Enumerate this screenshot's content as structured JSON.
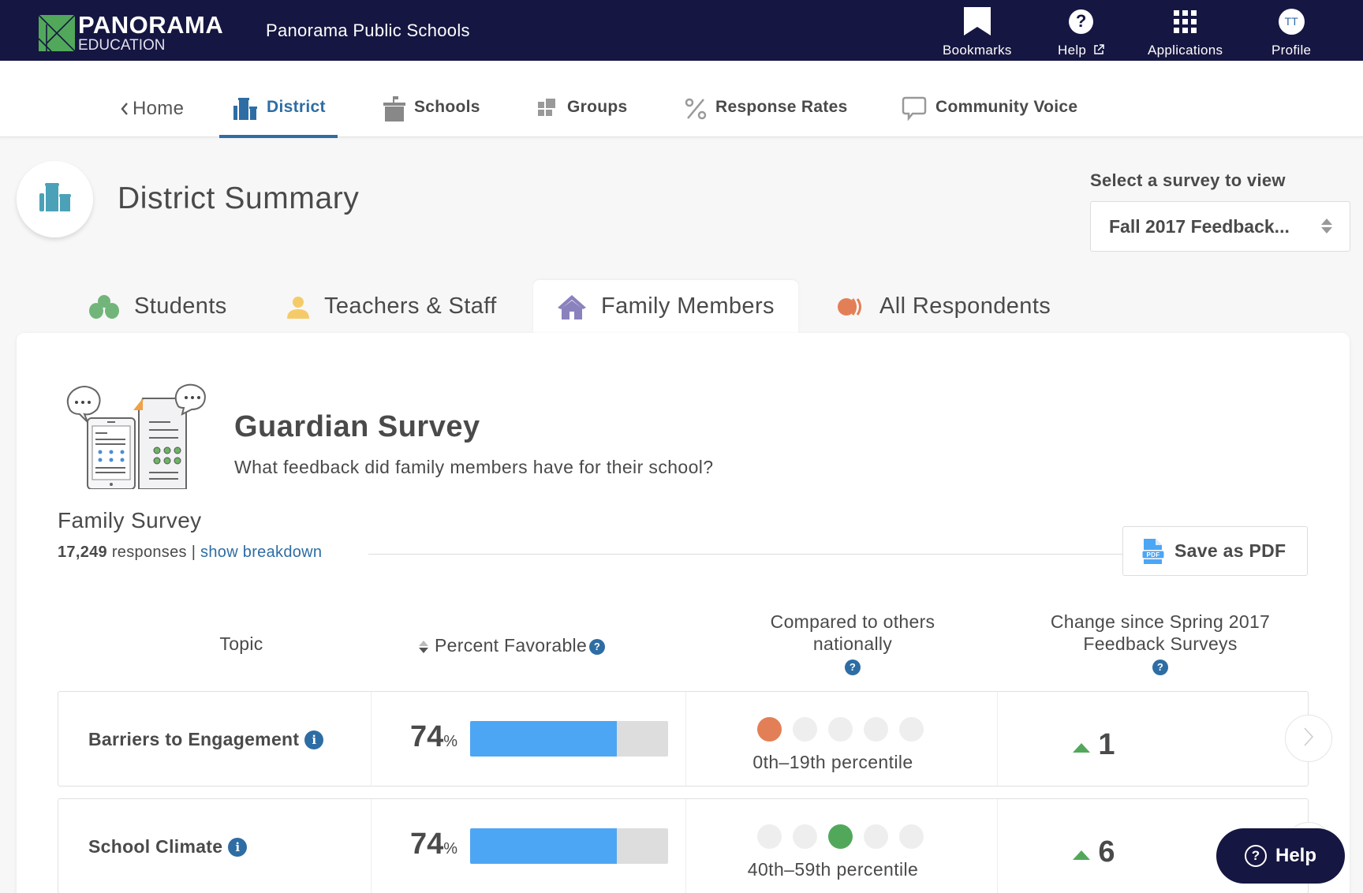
{
  "header": {
    "logo_primary": "PANORAMA",
    "logo_secondary": "EDUCATION",
    "district_name": "Panorama Public Schools",
    "items": [
      {
        "label": "Bookmarks",
        "icon": "bookmark-icon"
      },
      {
        "label": "Help",
        "icon": "help-icon",
        "external": true
      },
      {
        "label": "Applications",
        "icon": "apps-grid-icon"
      },
      {
        "label": "Profile",
        "icon": "avatar",
        "initials": "TT"
      }
    ]
  },
  "nav": {
    "home_label": "Home",
    "items": [
      {
        "label": "District",
        "icon": "district-icon",
        "active": true
      },
      {
        "label": "Schools",
        "icon": "school-podium-icon"
      },
      {
        "label": "Groups",
        "icon": "groups-icon"
      },
      {
        "label": "Response Rates",
        "icon": "percent-icon"
      },
      {
        "label": "Community Voice",
        "icon": "speech-bubble-icon"
      }
    ]
  },
  "page": {
    "title": "District Summary",
    "select_label": "Select a survey to view",
    "selected_survey": "Fall 2017 Feedback..."
  },
  "respondent_tabs": [
    {
      "label": "Students",
      "icon": "students-icon",
      "color": "#72b57a"
    },
    {
      "label": "Teachers & Staff",
      "icon": "teacher-icon",
      "color": "#f5cb6a"
    },
    {
      "label": "Family Members",
      "icon": "house-icon",
      "color": "#8a82bd",
      "active": true
    },
    {
      "label": "All Respondents",
      "icon": "all-respondents-icon",
      "color": "#e37f57"
    }
  ],
  "survey": {
    "title": "Guardian Survey",
    "subtitle": "What feedback did family members have for their school?",
    "name": "Family Survey",
    "response_count": "17,249",
    "responses_word": "responses",
    "separator": "|",
    "breakdown_link": "show breakdown",
    "save_pdf_label": "Save as PDF",
    "pdf_icon_text": "PDF"
  },
  "table": {
    "headers": {
      "topic": "Topic",
      "percent_favorable": "Percent Favorable",
      "compared_line1": "Compared to others",
      "compared_line2": "nationally",
      "change_line1": "Change since Spring 2017",
      "change_line2": "Feedback Surveys",
      "help_glyph": "?"
    },
    "rows": [
      {
        "topic": "Barriers to Engagement",
        "percent": "74",
        "percent_value": 0.74,
        "percent_sign": "%",
        "percentile_label": "0th–19th percentile",
        "percentile_bucket": 0,
        "bucket_color": "#e37f57",
        "change": "1",
        "change_direction": "up"
      },
      {
        "topic": "School Climate",
        "percent": "74",
        "percent_value": 0.74,
        "percent_sign": "%",
        "percentile_label": "40th–59th percentile",
        "percentile_bucket": 2,
        "bucket_color": "#52a85a",
        "change": "6",
        "change_direction": "up"
      }
    ]
  },
  "help_fab": {
    "label": "Help",
    "glyph": "?"
  },
  "colors": {
    "header_bg": "#151641",
    "accent": "#2e6da4",
    "bar_fill": "#4da6f4",
    "bar_track": "#dddddd",
    "up_arrow": "#52a85a"
  }
}
